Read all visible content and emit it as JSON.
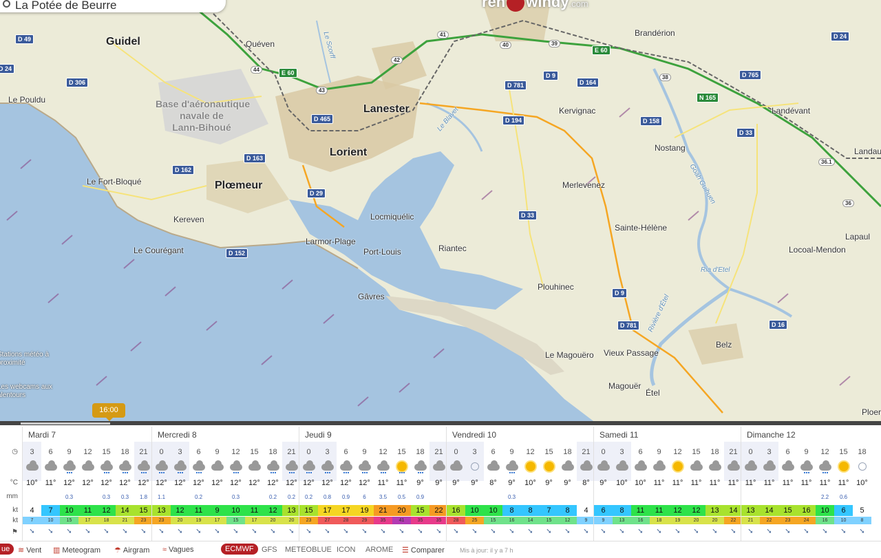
{
  "search": {
    "value": "La Potée de Beurre"
  },
  "logo": {
    "left": "ren",
    "right": "windy",
    "suffix": ".com"
  },
  "time_bubble": "16:00",
  "map": {
    "big_labels": [
      "Guidel",
      "Lanester",
      "Lorient",
      "Plœmeur"
    ],
    "labels": [
      "Quéven",
      "Brandérion",
      "Le Pouldu",
      "Kervignac",
      "Landévant",
      "Nostang",
      "Landau",
      "Le Fort-Bloqué",
      "Merlevenez",
      "Kereven",
      "Sainte-Hélène",
      "Lapaul",
      "Locmiquélic",
      "Larmor-Plage",
      "Le Courégant",
      "Port-Louis",
      "Riantec",
      "Locoal-Mendon",
      "Plouhinec",
      "Gâvres",
      "Belz",
      "Le Magouëro",
      "Vieux Passage",
      "Magouër",
      "Étel",
      "Ploer"
    ],
    "base": [
      "Base d'aéronautique",
      "navale de",
      "Lann-Bihoué"
    ],
    "water": [
      "Le Scorff",
      "Le Blavet",
      "Goah Guihuen",
      "Ria d'Etel",
      "Rivière d'Étel"
    ],
    "roads": [
      "D 49",
      "D 24",
      "D 306",
      "E 60",
      "D 465",
      "D 781",
      "D 9",
      "D 164",
      "D 765",
      "N 165",
      "D 194",
      "D 158",
      "D 33",
      "D 163",
      "D 162",
      "D 29",
      "D 33",
      "D 152",
      "D 9",
      "D 781",
      "D 16",
      "D 24",
      "E 60"
    ],
    "junctions": [
      "44",
      "43",
      "42",
      "41",
      "40",
      "39",
      "38",
      "36.1",
      "36"
    ],
    "side_stations": [
      "Stations météo à",
      "proximité"
    ],
    "side_webcams": [
      "Les webcams aux",
      "alentours"
    ]
  },
  "forecast": {
    "row_labels": {
      "hour": "",
      "temp": "°C",
      "rain": "mm",
      "wind": "kt",
      "gust": "kt"
    },
    "days": [
      {
        "name": "Mardi 7",
        "hours": [
          "3",
          "6",
          "9",
          "12",
          "15",
          "18",
          "21"
        ],
        "temps": [
          "10°",
          "11°",
          "12°",
          "12°",
          "12°",
          "12°",
          "12°"
        ],
        "rain": [
          "",
          "",
          "0.3",
          "",
          "0.3",
          "0.3",
          "1.8"
        ],
        "wind": [
          "4",
          "7",
          "10",
          "11",
          "12",
          "14",
          "15"
        ],
        "gust": [
          "7",
          "10",
          "15",
          "17",
          "18",
          "21",
          "23"
        ],
        "icons": [
          "moon-cloud",
          "cloud",
          "rain",
          "cloud",
          "rain",
          "rain",
          "rain"
        ]
      },
      {
        "name": "Mercredi 8",
        "hours": [
          "0",
          "3",
          "6",
          "9",
          "12",
          "15",
          "18",
          "21"
        ],
        "temps": [
          "12°",
          "12°",
          "12°",
          "12°",
          "12°",
          "12°",
          "12°",
          "12°"
        ],
        "rain": [
          "1.1",
          "",
          "0.2",
          "",
          "0.3",
          "",
          "0.2",
          "0.2"
        ],
        "wind": [
          "13",
          "12",
          "11",
          "9",
          "10",
          "11",
          "12",
          "13"
        ],
        "gust": [
          "23",
          "20",
          "19",
          "17",
          "15",
          "17",
          "20",
          "20"
        ],
        "icons": [
          "rain",
          "rain",
          "rain",
          "cloud",
          "rain",
          "cloud",
          "rain",
          "rain"
        ]
      },
      {
        "name": "Jeudi 9",
        "hours": [
          "0",
          "3",
          "6",
          "9",
          "12",
          "15",
          "18",
          "21"
        ],
        "temps": [
          "12°",
          "12°",
          "12°",
          "12°",
          "11°",
          "11°",
          "9°",
          "9°"
        ],
        "rain": [
          "0.2",
          "0.8",
          "0.9",
          "6",
          "3.5",
          "0.5",
          "0.9",
          ""
        ],
        "wind": [
          "15",
          "17",
          "17",
          "19",
          "21",
          "20",
          "15",
          "22"
        ],
        "gust": [
          "23",
          "27",
          "28",
          "29",
          "35",
          "41",
          "35",
          "35"
        ],
        "icons": [
          "rain",
          "rain",
          "rain",
          "rain",
          "rain",
          "sun-rain",
          "moon-rain",
          "cloud"
        ]
      },
      {
        "name": "Vendredi 10",
        "hours": [
          "0",
          "3",
          "6",
          "9",
          "12",
          "15",
          "18",
          "21"
        ],
        "temps": [
          "9°",
          "9°",
          "8°",
          "9°",
          "10°",
          "9°",
          "9°",
          "8°"
        ],
        "rain": [
          "",
          "",
          "",
          "0.3",
          "",
          "",
          "",
          ""
        ],
        "wind": [
          "16",
          "10",
          "10",
          "8",
          "8",
          "7",
          "8",
          "4"
        ],
        "gust": [
          "28",
          "25",
          "15",
          "16",
          "14",
          "15",
          "12",
          "9"
        ],
        "icons": [
          "cloud",
          "moon",
          "cloud",
          "moon-rain",
          "sun",
          "sun",
          "cloud",
          "moon-cloud"
        ]
      },
      {
        "name": "Samedi 11",
        "hours": [
          "0",
          "3",
          "6",
          "9",
          "12",
          "15",
          "18",
          "21"
        ],
        "temps": [
          "9°",
          "10°",
          "10°",
          "11°",
          "11°",
          "11°",
          "11°",
          "11°"
        ],
        "rain": [
          "",
          "",
          "",
          "",
          "",
          "",
          "",
          ""
        ],
        "wind": [
          "6",
          "8",
          "11",
          "11",
          "12",
          "12",
          "13",
          "14"
        ],
        "gust": [
          "9",
          "13",
          "16",
          "18",
          "19",
          "20",
          "20",
          "22"
        ],
        "icons": [
          "cloud",
          "cloud",
          "cloud",
          "moon-cloud",
          "sun-cloud",
          "cloud",
          "cloud",
          "cloud"
        ]
      },
      {
        "name": "Dimanche 12",
        "hours": [
          "0",
          "3",
          "6",
          "9",
          "12",
          "15",
          "18"
        ],
        "temps": [
          "11°",
          "11°",
          "11°",
          "11°",
          "11°",
          "11°",
          "10°"
        ],
        "rain": [
          "",
          "",
          "",
          "",
          "2.2",
          "0.6",
          ""
        ],
        "wind": [
          "13",
          "14",
          "15",
          "16",
          "10",
          "6",
          "5"
        ],
        "gust": [
          "21",
          "22",
          "23",
          "24",
          "16",
          "10",
          "8"
        ],
        "icons": [
          "cloud",
          "cloud",
          "cloud",
          "rain",
          "rain",
          "sun",
          "moon"
        ]
      }
    ]
  },
  "bottom": {
    "tab0": "ue",
    "items": [
      "Vent",
      "Meteogram",
      "Airgram",
      "Vagues"
    ],
    "models": [
      "ECMWF",
      "GFS",
      "METEOBLUE",
      "ICON",
      "AROME"
    ],
    "compare": "Comparer",
    "updated": "Mis à jour: il y a 7 h"
  },
  "colors": {
    "accent": "#b52025",
    "sea": "#a5c4e0",
    "land": "#ecebd8"
  }
}
